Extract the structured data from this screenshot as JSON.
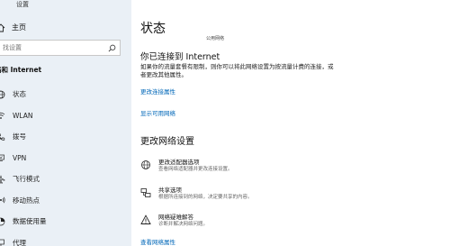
{
  "window": {
    "title": "设置"
  },
  "sidebar": {
    "home_label": "主页",
    "search_placeholder": "找设置",
    "section_title": "络和 Internet",
    "items": [
      {
        "label": "状态",
        "icon": "globe-icon"
      },
      {
        "label": "WLAN",
        "icon": "wifi-icon"
      },
      {
        "label": "拨号",
        "icon": "phone-icon"
      },
      {
        "label": "VPN",
        "icon": "vpn-icon"
      },
      {
        "label": "飞行模式",
        "icon": "airplane-icon"
      },
      {
        "label": "移动热点",
        "icon": "hotspot-icon"
      },
      {
        "label": "数据使用量",
        "icon": "data-usage-icon"
      },
      {
        "label": "代理",
        "icon": "proxy-icon"
      }
    ]
  },
  "main": {
    "title": "状态",
    "network_name": "公用网络",
    "connection_heading": "你已连接到 Internet",
    "connection_desc": "如果你的流量套餐有限制，则你可以将此网络设置为按流量计费的连接，或者更改其他属性。",
    "change_properties_link": "更改连接属性",
    "show_networks_link": "显示可用网络",
    "change_settings_heading": "更改网络设置",
    "options": [
      {
        "title": "更改适配器选项",
        "desc": "查看网络适配器并更改连接设置。",
        "icon": "adapter-icon"
      },
      {
        "title": "共享选项",
        "desc": "根据所连接到的网络，决定要共享的内容。",
        "icon": "sharing-icon"
      },
      {
        "title": "网络疑难解答",
        "desc": "诊断并解决网络问题。",
        "icon": "troubleshoot-icon"
      }
    ],
    "view_properties_link": "查看网络属性"
  },
  "colors": {
    "sidebar_bg": "#eaf0f6",
    "link": "#0067b8"
  }
}
